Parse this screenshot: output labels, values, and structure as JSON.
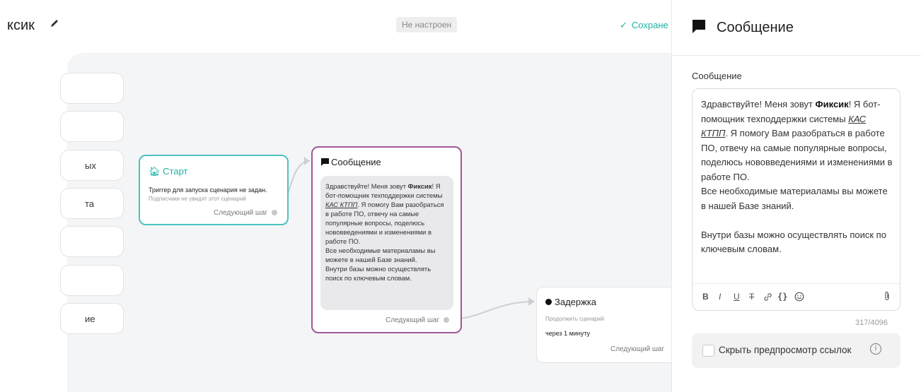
{
  "header": {
    "title_fragment": "ксик",
    "status": "Не настроен",
    "save_label": "Сохране"
  },
  "side_buttons": [
    {
      "label": ""
    },
    {
      "label": ""
    },
    {
      "label": "ых"
    },
    {
      "label": "та"
    },
    {
      "label": ""
    },
    {
      "label": ""
    },
    {
      "label": "ие"
    }
  ],
  "nodes": {
    "start": {
      "title": "Старт",
      "line1": "Триггер для запуска сценария не задан.",
      "line2": "Подписчики не увидят этот сценарий",
      "next": "Следующий шаг"
    },
    "message": {
      "title": "Сообщение",
      "next": "Следующий шаг",
      "text": {
        "p1_a": "Здравствуйте! Меня зовут ",
        "p1_name": "Фиксик",
        "p1_b": "! Я бот-помощник техподдержки системы ",
        "p1_link": "КАС КТПП",
        "p1_c": ". Я помогу Вам разобраться в работе ПО, отвечу на самые популярные вопросы, поделюсь нововведениями и изменениями в работе ПО.",
        "p2": "Все необходимые материаламы вы можете в нашей Базе знаний.",
        "p3": "Внутри базы можно осуществлять поиск по ключевым словам."
      }
    },
    "delay": {
      "title": "Задержка",
      "line1": "Продолжить сценарий",
      "line2": "через 1 минуту",
      "next": "Следующий шаг"
    }
  },
  "panel": {
    "title": "Сообщение",
    "field_label": "Сообщение",
    "editor": {
      "p1_a": "Здравствуйте! Меня зовут ",
      "p1_name": "Фиксик",
      "p1_b": "! Я бот-помощник техподдержки системы ",
      "p1_link": "КАС КТПП",
      "p1_c": ". Я помогу Вам разобраться в работе ПО, отвечу на самые популярные вопросы, поделюсь нововведениями и изменениями в работе ПО.",
      "p2": "Все необходимые материаламы вы можете в нашей Базе знаний.",
      "p3": "Внутри базы можно осуществлять поиск по ключевым словам."
    },
    "toolbar": {
      "bold": "B",
      "italic": "I",
      "underline": "U",
      "strike": "T",
      "variables": "{}"
    },
    "counter": "317/4096",
    "hide_preview_label": "Скрыть предпросмотр ссылок",
    "hide_preview_checked": false
  },
  "icons": [
    "pencil-icon",
    "check-icon",
    "home-icon",
    "message-icon",
    "delay-icon",
    "link-icon",
    "emoji-icon",
    "attach-icon",
    "info-icon"
  ],
  "colors": {
    "accent": "#1fb3a6",
    "start_border": "#4cc3bf",
    "message_border": "#a1569c",
    "canvas": "#f4f5f7"
  }
}
